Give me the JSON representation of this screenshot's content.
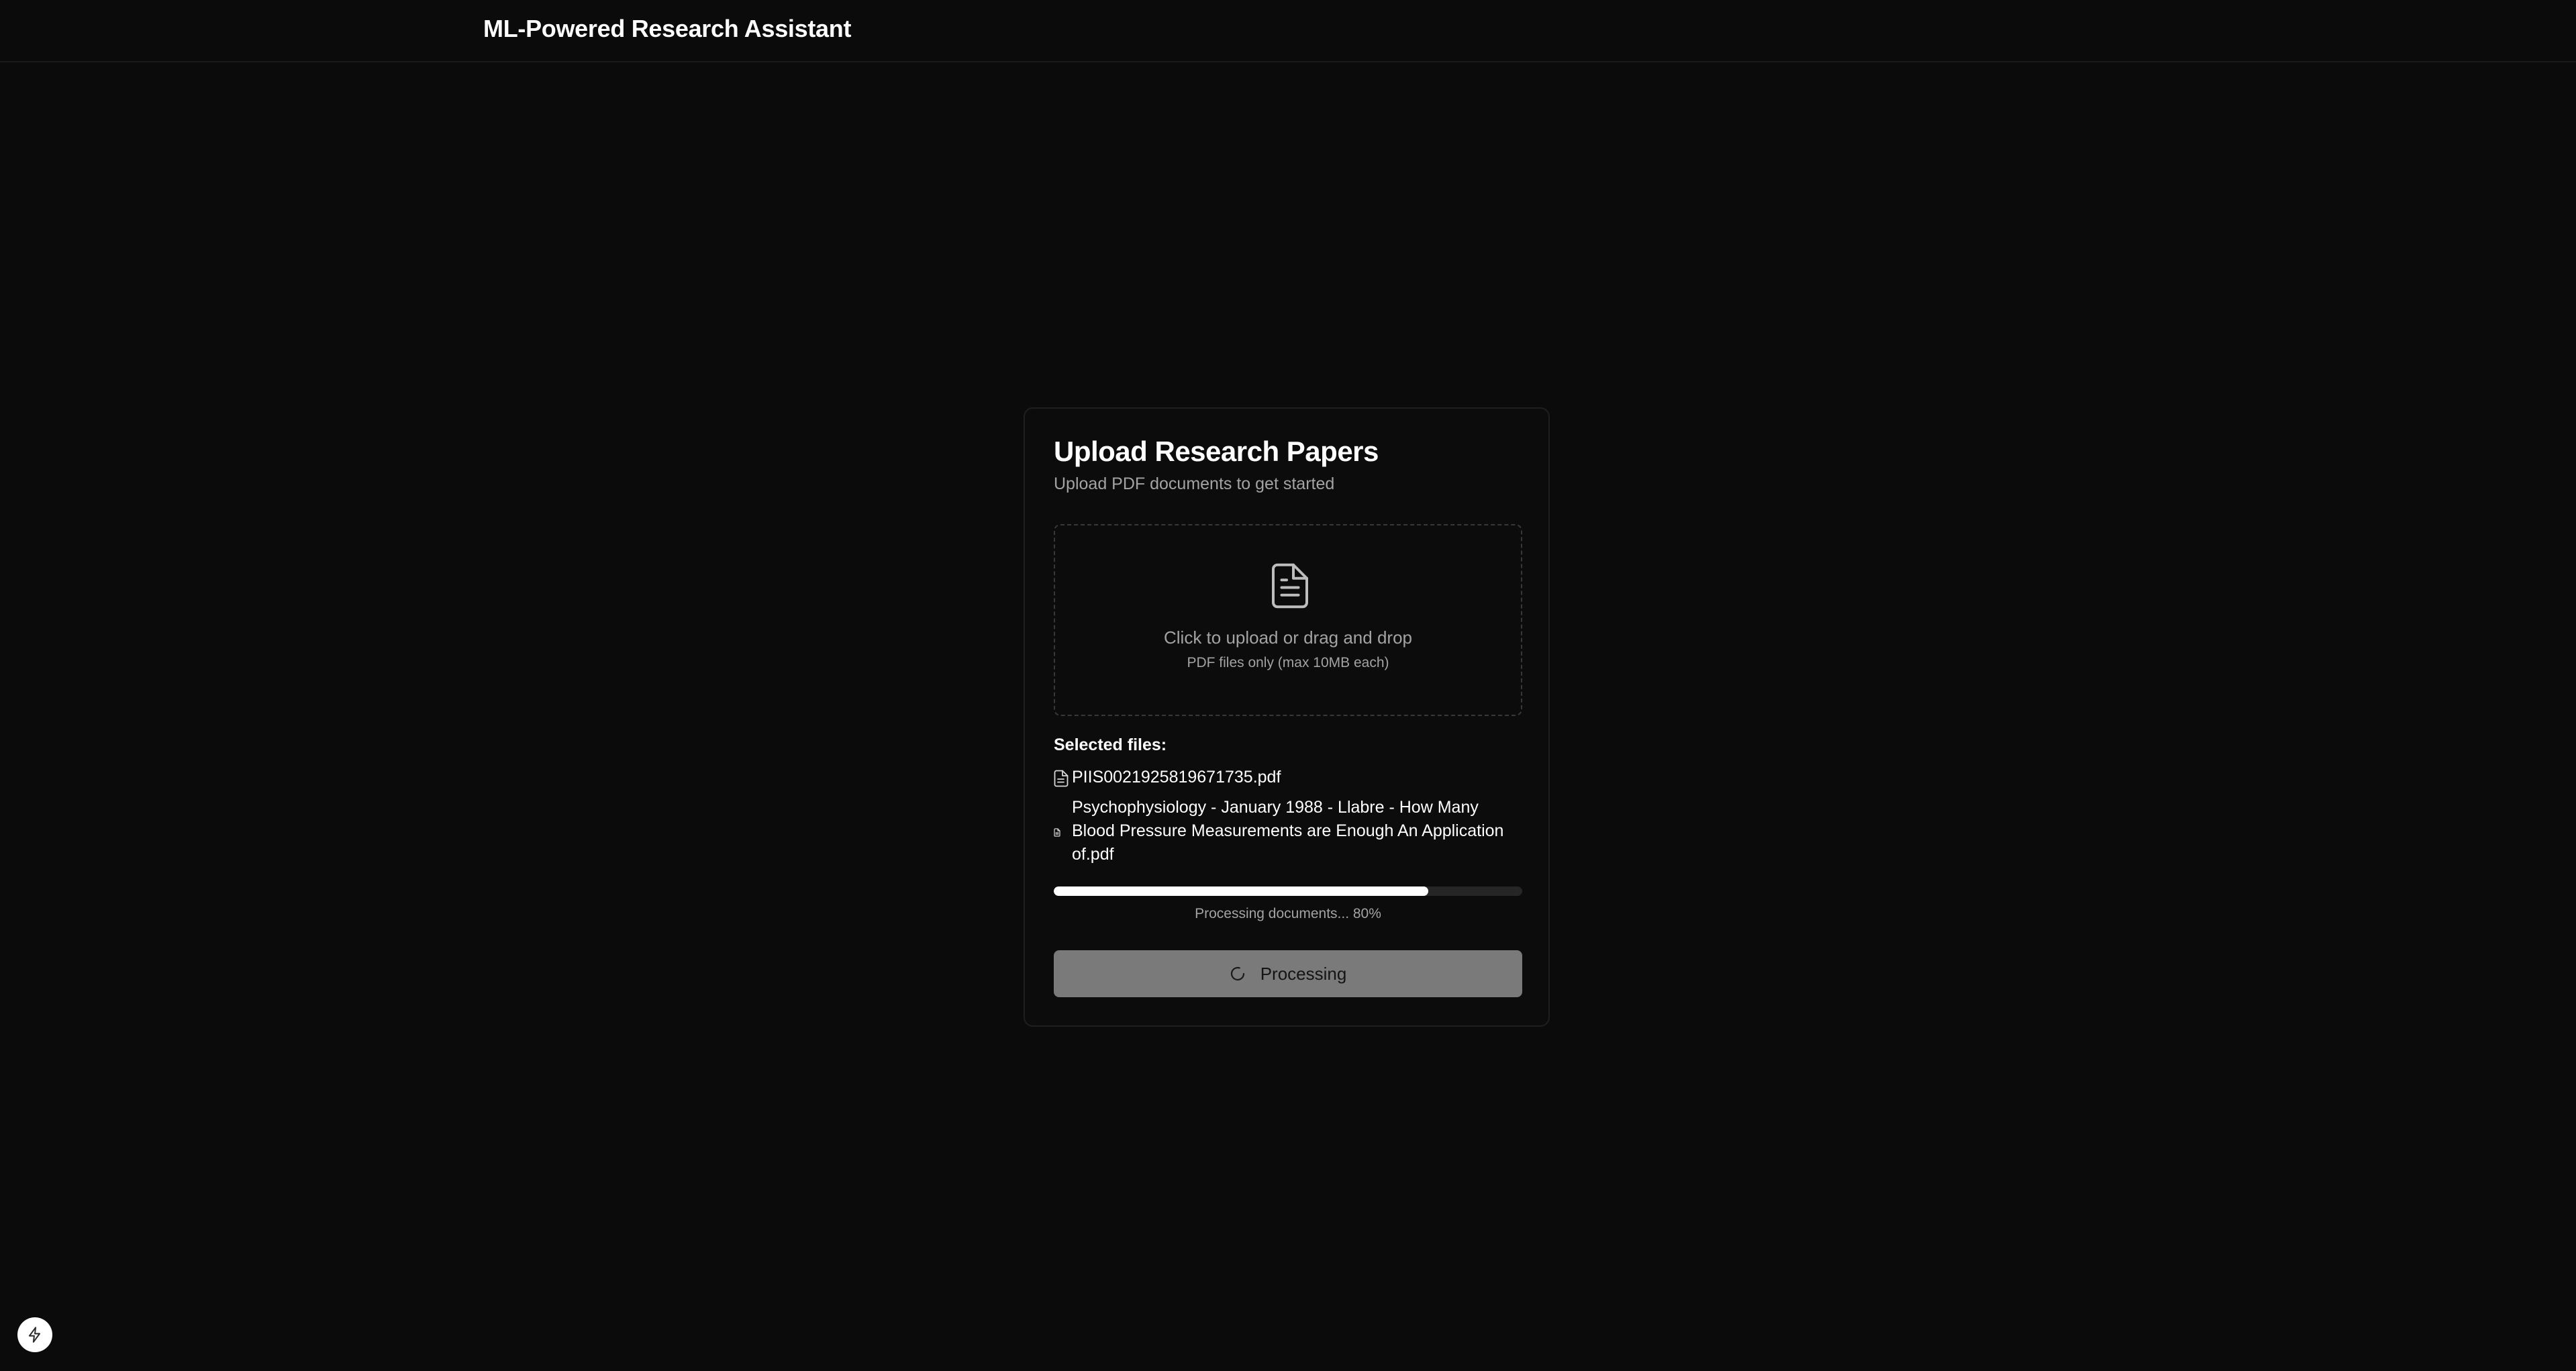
{
  "header": {
    "app_title": "ML-Powered Research Assistant"
  },
  "upload_card": {
    "title": "Upload Research Papers",
    "subtitle": "Upload PDF documents to get started",
    "dropzone": {
      "icon": "file-text-icon",
      "main_text": "Click to upload or drag and drop",
      "sub_text": "PDF files only (max 10MB each)"
    },
    "selected_files_label": "Selected files:",
    "files": [
      {
        "name": "PIIS0021925819671735.pdf",
        "icon": "file-icon"
      },
      {
        "name": "Psychophysiology - January 1988 - Llabre - How Many Blood Pressure Measurements are Enough An Application of.pdf",
        "icon": "file-icon"
      }
    ],
    "progress": {
      "percent": 80,
      "text": "Processing documents... 80%"
    },
    "button": {
      "label": "Processing",
      "icon": "spinner-icon"
    }
  },
  "corner_badge": {
    "icon": "lightning-icon"
  },
  "colors": {
    "background": "#0b0b0b",
    "text_primary": "#ffffff",
    "text_muted": "#a3a3a3",
    "progress_fill": "#ffffff",
    "button_disabled": "#7a7a7a"
  }
}
